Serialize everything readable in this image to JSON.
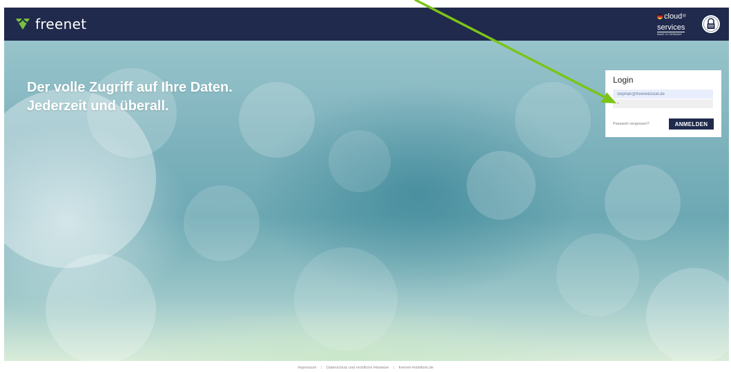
{
  "header": {
    "brand_name": "freenet",
    "logo_icon": "freenet-heart-logo-icon",
    "cloud_badge": {
      "line1": "cloud",
      "line1_sup": "®",
      "line2": "services",
      "line3": "MADE IN GERMANY"
    },
    "seal_icon": "security-seal-lock-icon"
  },
  "hero": {
    "headline_line1": "Der volle Zugriff auf Ihre Daten.",
    "headline_line2": "Jederzeit und überall."
  },
  "login": {
    "title": "Login",
    "email_value": "stephan@freenetcloud.de",
    "password_value": "•",
    "forgot_password": "Passwort vergessen?",
    "submit_label": "ANMELDEN"
  },
  "footer": {
    "links": [
      "Impressum",
      "Datenschutz und rechtliche Hinweise",
      "freenet-mobilfunk.de"
    ]
  },
  "colors": {
    "header_bg": "#1f2a4c",
    "brand_green": "#7ac142",
    "button_bg": "#1f2a4c",
    "annotation_arrow": "#7cc417"
  }
}
